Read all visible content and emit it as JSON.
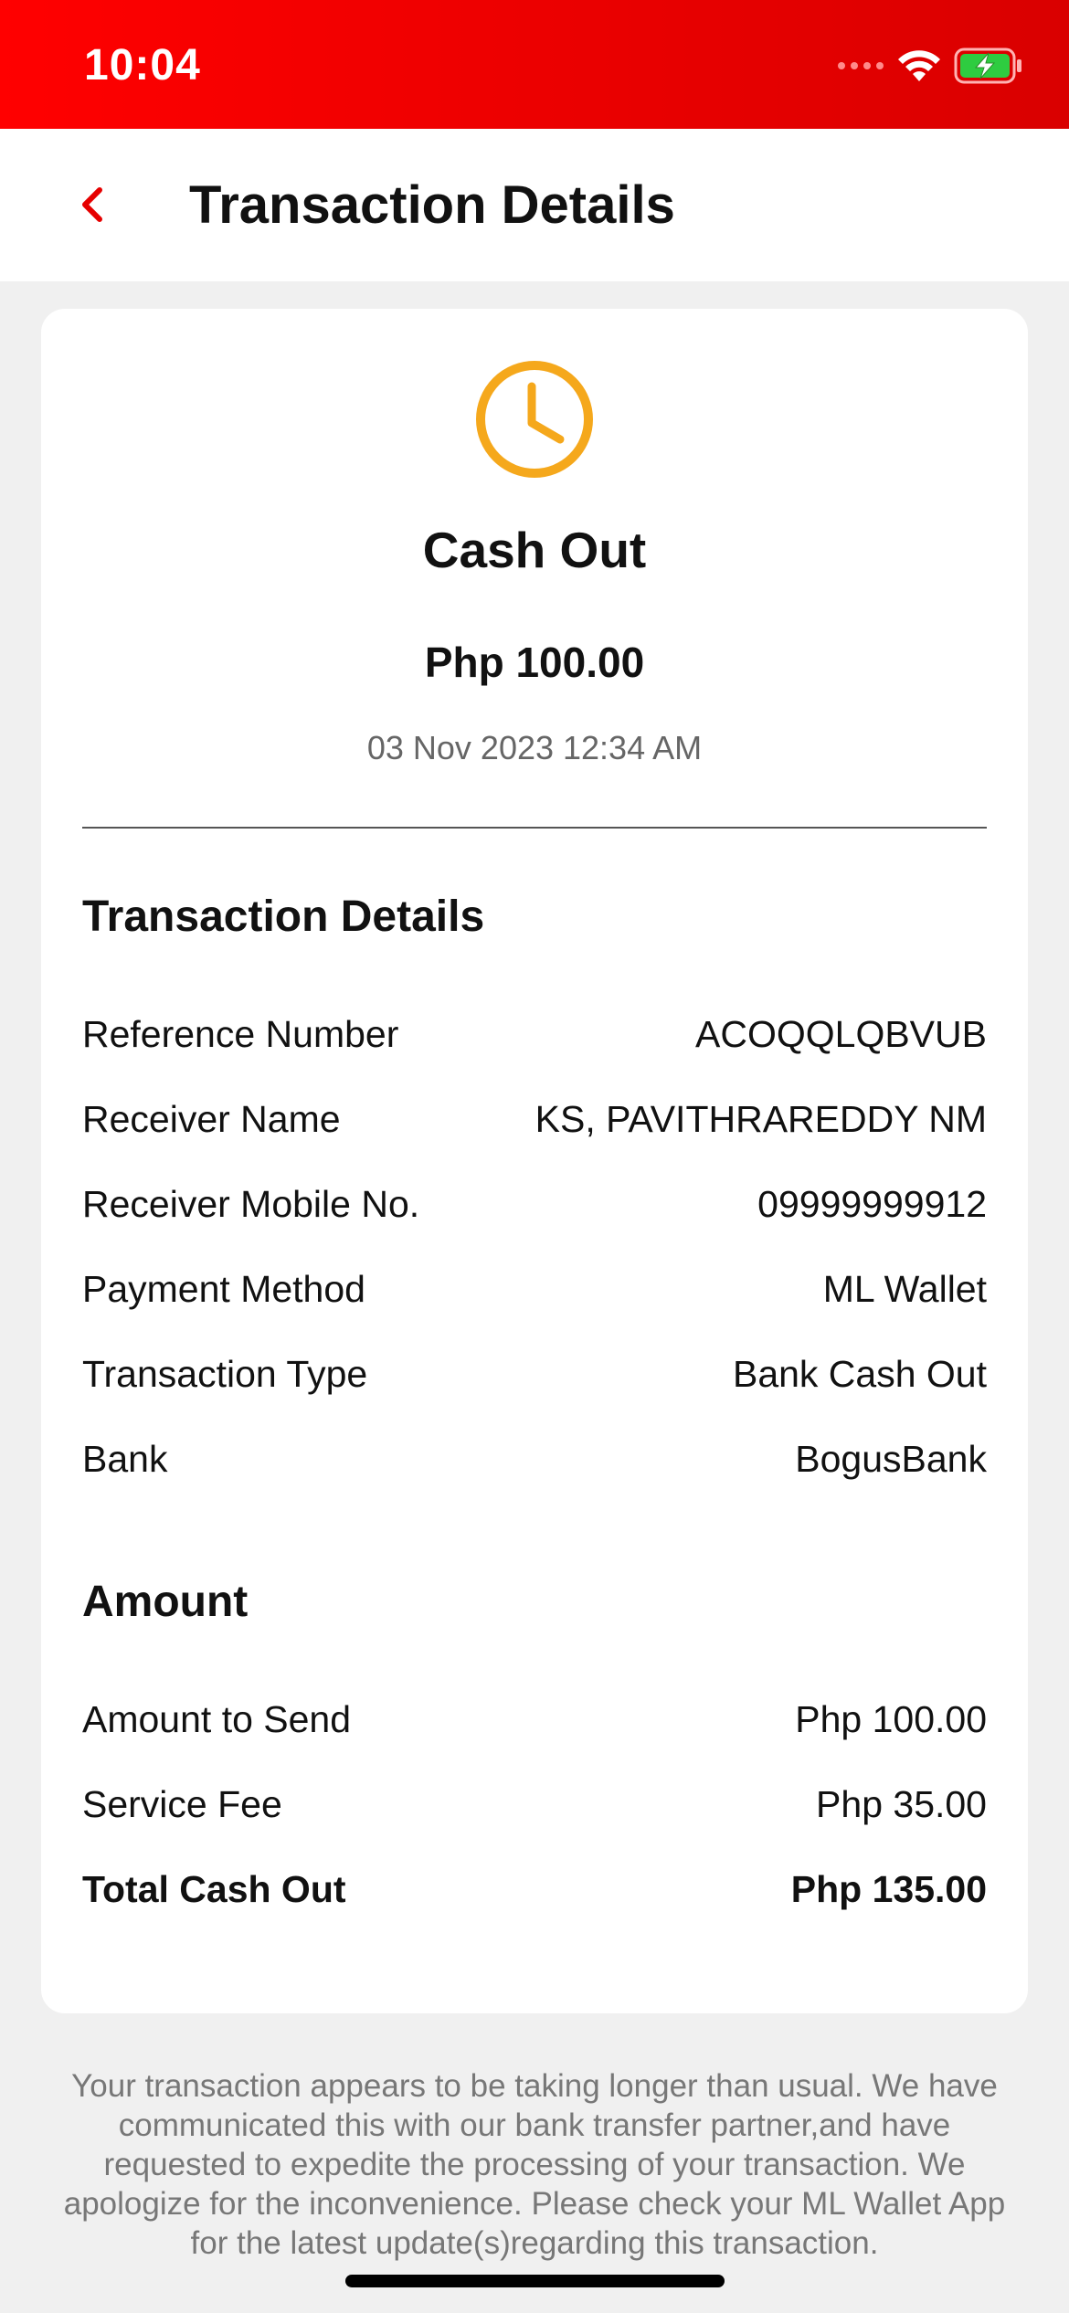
{
  "status_bar": {
    "time": "10:04"
  },
  "header": {
    "title": "Transaction Details"
  },
  "summary": {
    "type": "Cash Out",
    "amount": "Php 100.00",
    "datetime": "03 Nov 2023 12:34 AM"
  },
  "details": {
    "title": "Transaction Details",
    "rows": [
      {
        "label": "Reference Number",
        "value": "ACOQQLQBVUB"
      },
      {
        "label": "Receiver Name",
        "value": "KS, PAVITHRAREDDY NM"
      },
      {
        "label": "Receiver Mobile No.",
        "value": "09999999912"
      },
      {
        "label": "Payment Method",
        "value": "ML Wallet"
      },
      {
        "label": "Transaction Type",
        "value": "Bank Cash Out"
      },
      {
        "label": "Bank",
        "value": "BogusBank"
      }
    ]
  },
  "amount": {
    "title": "Amount",
    "rows": [
      {
        "label": "Amount to Send",
        "value": "Php 100.00"
      },
      {
        "label": "Service Fee",
        "value": "Php 35.00"
      },
      {
        "label": "Total Cash Out",
        "value": "Php 135.00"
      }
    ]
  },
  "notice": "Your transaction appears to be taking longer than usual. We have communicated this with our bank transfer partner,and have requested to expedite the processing of your transaction. We apologize for the inconvenience. Please check your ML Wallet App for the latest update(s)regarding this transaction.",
  "colors": {
    "brand_red": "#e60000",
    "pending_yellow": "#f5a81c",
    "battery_green": "#2ecc40"
  }
}
